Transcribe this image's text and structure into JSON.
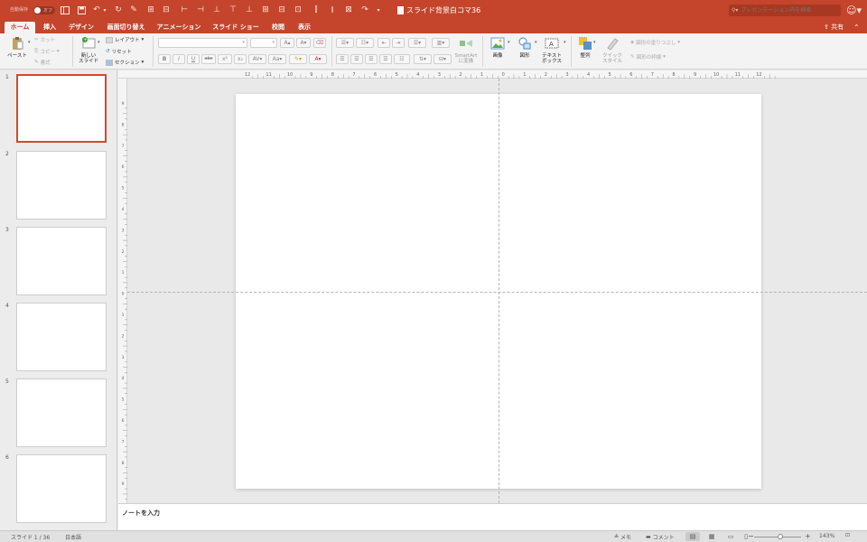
{
  "titlebar": {
    "autosave_label": "自動保存",
    "autosave_state": "オフ",
    "document_title": "スライド背景白コマ36",
    "search_placeholder": "プレゼンテーション内を検索",
    "qat_icons": [
      "sidebar-toggle-icon",
      "save-icon",
      "undo-icon",
      "undo-dropdown-icon",
      "redo-icon",
      "format-painter-icon",
      "new-slide-icon",
      "new-slide-dropdown-icon",
      "align-left-icon",
      "align-center-icon",
      "align-right-icon",
      "align-top-icon",
      "align-middle-icon",
      "align-bottom-icon",
      "distribute-horizontal-icon",
      "distribute-vertical-icon",
      "customize-toolbar-icon"
    ],
    "user_icon": "smiley-icon"
  },
  "tabs": [
    {
      "label": "ホーム",
      "active": true
    },
    {
      "label": "挿入"
    },
    {
      "label": "デザイン"
    },
    {
      "label": "画面切り替え"
    },
    {
      "label": "アニメーション"
    },
    {
      "label": "スライド ショー"
    },
    {
      "label": "校閲"
    },
    {
      "label": "表示"
    }
  ],
  "share_label": "共有",
  "ribbon": {
    "paste": "ペースト",
    "cut": "カット",
    "copy": "コピー",
    "format": "書式",
    "new_slide_line1": "新しい",
    "new_slide_line2": "スライド",
    "layout": "レイアウト",
    "reset": "リセット",
    "section": "セクション",
    "bold": "B",
    "italic": "I",
    "underline": "U",
    "strikethrough": "abc",
    "font_grow": "A",
    "font_shrink": "A",
    "font_color": "A",
    "smartart_line1": "SmartArt",
    "smartart_line2": "に変換",
    "picture": "画像",
    "shapes": "図形",
    "textbox_line1": "テキスト",
    "textbox_line2": "ボックス",
    "arrange": "整列",
    "quick_styles_line1": "クイック",
    "quick_styles_line2": "スタイル",
    "shape_fill": "図形の塗りつぶし",
    "shape_outline": "図形の枠線"
  },
  "slides": [
    {
      "number": "1",
      "selected": true
    },
    {
      "number": "2"
    },
    {
      "number": "3"
    },
    {
      "number": "4"
    },
    {
      "number": "5"
    },
    {
      "number": "6"
    }
  ],
  "ruler": {
    "horizontal": [
      "12",
      "11",
      "10",
      "9",
      "8",
      "7",
      "6",
      "5",
      "4",
      "3",
      "2",
      "1",
      "0",
      "1",
      "2",
      "3",
      "4",
      "5",
      "6",
      "7",
      "8",
      "9",
      "10",
      "11",
      "12"
    ],
    "vertical": [
      "9",
      "8",
      "7",
      "6",
      "5",
      "4",
      "3",
      "2",
      "1",
      "0",
      "1",
      "2",
      "3",
      "4",
      "5",
      "6",
      "7",
      "8",
      "9"
    ]
  },
  "notes_placeholder": "ノートを入力",
  "statusbar": {
    "slide_info": "スライド 1 / 36",
    "language": "日本語",
    "notes_label": "メモ",
    "comments_label": "コメント",
    "zoom_level": "143%",
    "zoom_fraction": 0.55
  }
}
